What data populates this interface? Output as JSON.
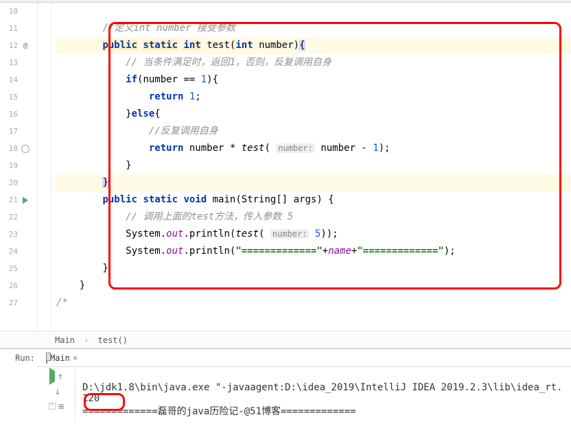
{
  "gutter": {
    "lines": [
      "10",
      "11",
      "12",
      "13",
      "14",
      "15",
      "16",
      "17",
      "18",
      "19",
      "20",
      "21",
      "22",
      "23",
      "24",
      "25",
      "26",
      "27"
    ]
  },
  "code": {
    "l11_comment": "//定义int number 接受参数",
    "l12_public": "public",
    "l12_static": "static",
    "l12_int": "int",
    "l12_test": " test(",
    "l12_int2": "int",
    "l12_number": " number)",
    "l13_comment": "// 当条件满足时，返回1，否则，反复调用自身",
    "l14_if": "if",
    "l14_cond": "(number == ",
    "l14_one": "1",
    "l14_close": "){",
    "l15_return": "return",
    "l15_one": "1",
    "l16_else": "else",
    "l17_comment": "//反复调用自身",
    "l18_return": "return",
    "l18_expr1": " number * ",
    "l18_test": "test",
    "l18_hint": "number:",
    "l18_expr2": " number - ",
    "l18_one": "1",
    "l21_public": "public",
    "l21_static": "static",
    "l21_void": "void",
    "l21_main": " main(String[] args) {",
    "l22_comment": "// 调用上面的test方法，传入参数 5",
    "l23_sys": "System.",
    "l23_out": "out",
    "l23_println": ".println(",
    "l23_test": "test",
    "l23_hint": "number:",
    "l23_five": "5",
    "l24_sys": "System.",
    "l24_out": "out",
    "l24_println": ".println(",
    "l24_str1": "\"=============\"",
    "l24_plus1": "+",
    "l24_name": "name",
    "l24_plus2": "+",
    "l24_str2": "\"=============\"",
    "l27_comment": "/*"
  },
  "breadcrumb": {
    "item1": "Main",
    "item2": "test()"
  },
  "run": {
    "label": "Run:",
    "tab_name": "Main",
    "console_l1": "D:\\jdk1.8\\bin\\java.exe \"-javaagent:D:\\idea_2019\\IntelliJ IDEA 2019.2.3\\lib\\idea_rt.",
    "console_l2": "120",
    "console_l3": "=============磊哥的java历险记-@51博客============="
  }
}
